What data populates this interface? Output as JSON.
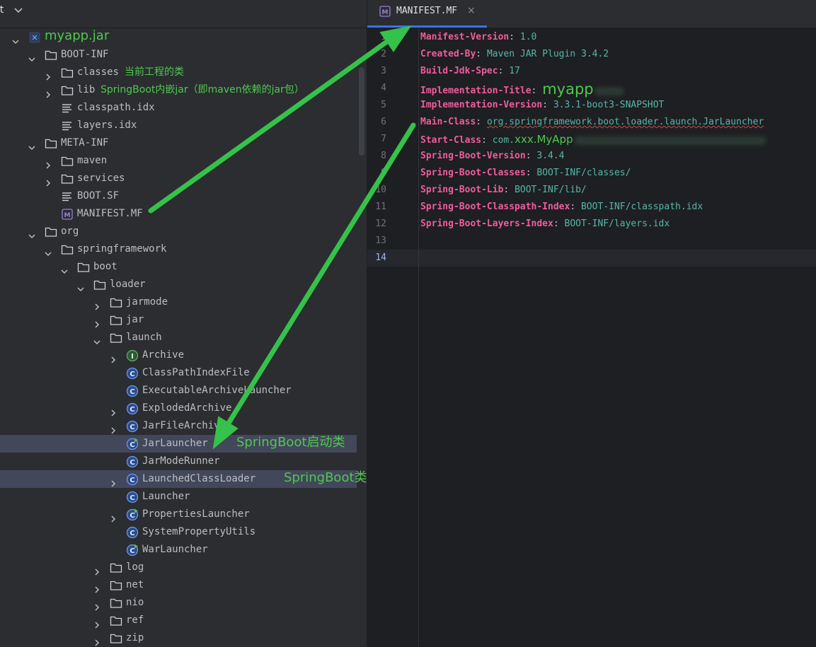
{
  "project_panel": {
    "title": "ct",
    "tree": [
      {
        "label": "myapp.jar",
        "depth": 0,
        "expanded": true,
        "icon": "jar-icon",
        "note": "",
        "highlight": true
      },
      {
        "label": "BOOT-INF",
        "depth": 1,
        "expanded": true,
        "icon": "folder-icon",
        "note": ""
      },
      {
        "label": "classes",
        "depth": 2,
        "expanded": false,
        "icon": "folder-icon",
        "note": "当前工程的类"
      },
      {
        "label": "lib",
        "depth": 2,
        "expanded": false,
        "icon": "folder-icon",
        "note": "SpringBoot内嵌jar（即maven依赖的jar包）"
      },
      {
        "label": "classpath.idx",
        "depth": 2,
        "icon": "text-file-icon",
        "note": ""
      },
      {
        "label": "layers.idx",
        "depth": 2,
        "icon": "text-file-icon",
        "note": ""
      },
      {
        "label": "META-INF",
        "depth": 1,
        "expanded": true,
        "icon": "folder-icon",
        "note": ""
      },
      {
        "label": "maven",
        "depth": 2,
        "expanded": false,
        "icon": "folder-icon",
        "note": ""
      },
      {
        "label": "services",
        "depth": 2,
        "expanded": false,
        "icon": "folder-icon",
        "note": ""
      },
      {
        "label": "BOOT.SF",
        "depth": 2,
        "icon": "text-file-icon",
        "note": ""
      },
      {
        "label": "MANIFEST.MF",
        "depth": 2,
        "icon": "manifest-icon",
        "note": ""
      },
      {
        "label": "org",
        "depth": 1,
        "expanded": true,
        "icon": "folder-icon",
        "note": ""
      },
      {
        "label": "springframework",
        "depth": 2,
        "expanded": true,
        "icon": "folder-icon",
        "note": ""
      },
      {
        "label": "boot",
        "depth": 3,
        "expanded": true,
        "icon": "folder-icon",
        "note": ""
      },
      {
        "label": "loader",
        "depth": 4,
        "expanded": true,
        "icon": "folder-icon",
        "note": ""
      },
      {
        "label": "jarmode",
        "depth": 5,
        "expanded": false,
        "icon": "folder-icon",
        "note": ""
      },
      {
        "label": "jar",
        "depth": 5,
        "expanded": false,
        "icon": "folder-icon",
        "note": ""
      },
      {
        "label": "launch",
        "depth": 5,
        "expanded": true,
        "icon": "folder-icon",
        "note": ""
      },
      {
        "label": "Archive",
        "depth": 6,
        "expanded": false,
        "icon": "interface-icon",
        "note": ""
      },
      {
        "label": "ClassPathIndexFile",
        "depth": 6,
        "icon": "class-icon",
        "note": ""
      },
      {
        "label": "ExecutableArchiveLauncher",
        "depth": 6,
        "icon": "class-icon",
        "note": ""
      },
      {
        "label": "ExplodedArchive",
        "depth": 6,
        "expanded": false,
        "icon": "class-icon",
        "note": ""
      },
      {
        "label": "JarFileArchive",
        "depth": 6,
        "expanded": false,
        "icon": "class-icon",
        "note": ""
      },
      {
        "label": "JarLauncher",
        "depth": 6,
        "icon": "runnable-class-icon",
        "note": "SpringBoot启动类",
        "selected": true
      },
      {
        "label": "JarModeRunner",
        "depth": 6,
        "icon": "class-icon",
        "note": ""
      },
      {
        "label": "LaunchedClassLoader",
        "depth": 6,
        "expanded": false,
        "icon": "class-icon",
        "note": "SpringBoot类加载器",
        "selected": true
      },
      {
        "label": "Launcher",
        "depth": 6,
        "icon": "class-icon",
        "note": ""
      },
      {
        "label": "PropertiesLauncher",
        "depth": 6,
        "expanded": false,
        "icon": "runnable-class-icon",
        "note": ""
      },
      {
        "label": "SystemPropertyUtils",
        "depth": 6,
        "icon": "class-icon",
        "note": ""
      },
      {
        "label": "WarLauncher",
        "depth": 6,
        "icon": "runnable-class-icon",
        "note": ""
      },
      {
        "label": "log",
        "depth": 5,
        "expanded": false,
        "icon": "folder-icon",
        "note": ""
      },
      {
        "label": "net",
        "depth": 5,
        "expanded": false,
        "icon": "folder-icon",
        "note": ""
      },
      {
        "label": "nio",
        "depth": 5,
        "expanded": false,
        "icon": "folder-icon",
        "note": ""
      },
      {
        "label": "ref",
        "depth": 5,
        "expanded": false,
        "icon": "folder-icon",
        "note": ""
      },
      {
        "label": "zip",
        "depth": 5,
        "expanded": false,
        "icon": "folder-icon",
        "note": ""
      }
    ]
  },
  "editor": {
    "tab": {
      "label": "MANIFEST.MF",
      "icon": "manifest-icon",
      "close": "×"
    },
    "current_line": "14",
    "lines": [
      {
        "no": "1",
        "key": "Manifest-Version",
        "value": "1.0"
      },
      {
        "no": "2",
        "key": "Created-By",
        "value": "Maven JAR Plugin 3.4.2"
      },
      {
        "no": "3",
        "key": "Build-Jdk-Spec",
        "value": "17"
      },
      {
        "no": "4",
        "key": "Implementation-Title",
        "value": "",
        "annotation": "myapp"
      },
      {
        "no": "5",
        "key": "Implementation-Version",
        "value": "3.3.1-boot3-SNAPSHOT"
      },
      {
        "no": "6",
        "key": "Main-Class",
        "value": "org.springframework.boot.loader.launch.JarLauncher",
        "error": true
      },
      {
        "no": "7",
        "key": "Start-Class",
        "value": "com.",
        "annotation": "xxx.MyApp"
      },
      {
        "no": "8",
        "key": "Spring-Boot-Version",
        "value": "3.4.4"
      },
      {
        "no": "9",
        "key": "Spring-Boot-Classes",
        "value": "BOOT-INF/classes/"
      },
      {
        "no": "10",
        "key": "Spring-Boot-Lib",
        "value": "BOOT-INF/lib/"
      },
      {
        "no": "11",
        "key": "Spring-Boot-Classpath-Index",
        "value": "BOOT-INF/classpath.idx"
      },
      {
        "no": "12",
        "key": "Spring-Boot-Layers-Index",
        "value": "BOOT-INF/layers.idx"
      },
      {
        "no": "13",
        "key": "",
        "value": ""
      },
      {
        "no": "14",
        "key": "",
        "value": ""
      }
    ]
  },
  "colors": {
    "annotation": "#3dbf3d",
    "arrow": "#35c24a",
    "accent": "#3574f0",
    "key": "#ef5d9d",
    "value": "#56b7a8"
  }
}
